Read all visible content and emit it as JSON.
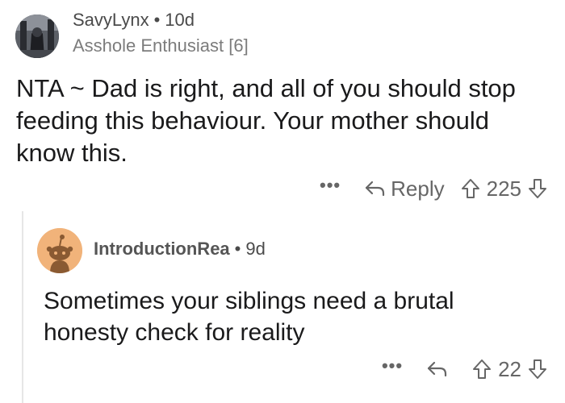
{
  "comment": {
    "author": "SavyLynx",
    "separator": "•",
    "age": "10d",
    "flair": "Asshole Enthusiast [6]",
    "body": "NTA ~ Dad is right, and all of you should stop feeding this behaviour. Your mother should know this.",
    "more_label": "•••",
    "reply_label": "Reply",
    "score": "225",
    "icons": [
      "avatar",
      "reply-icon",
      "upvote-icon",
      "downvote-icon"
    ]
  },
  "reply": {
    "author": "IntroductionRea",
    "separator": "•",
    "age": "9d",
    "body": "Sometimes your siblings need a brutal honesty check for reality",
    "more_label": "•••",
    "score": "22",
    "icons": [
      "snoo-avatar",
      "reply-icon",
      "upvote-icon",
      "downvote-icon"
    ]
  },
  "colors": {
    "text": "#1a1a1b",
    "meta": "#7c7c7c",
    "action": "#666666",
    "snoo_bg": "#f1b37a",
    "thread_line": "#e6e6e6"
  }
}
